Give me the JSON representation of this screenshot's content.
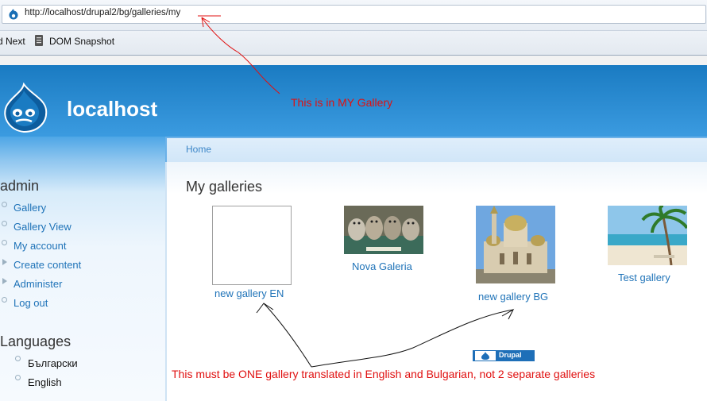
{
  "browser": {
    "url": "http://localhost/drupal2/bg/galleries/my",
    "bookmarks": [
      {
        "label": "d Next"
      },
      {
        "label": "DOM Snapshot"
      }
    ]
  },
  "site": {
    "name": "localhost"
  },
  "breadcrumb": {
    "home": "Home"
  },
  "sidebar": {
    "user_block_title": "admin",
    "nav": [
      {
        "label": "Gallery",
        "marker": "bullet"
      },
      {
        "label": "Gallery View",
        "marker": "bullet"
      },
      {
        "label": "My account",
        "marker": "bullet"
      },
      {
        "label": "Create content",
        "marker": "triangle"
      },
      {
        "label": "Administer",
        "marker": "triangle"
      },
      {
        "label": "Log out",
        "marker": "bullet"
      }
    ],
    "languages_title": "Languages",
    "languages": [
      {
        "label": "Български"
      },
      {
        "label": "English"
      }
    ]
  },
  "main": {
    "page_title": "My galleries",
    "galleries": [
      {
        "label": "new gallery EN",
        "image": "empty-placeholder"
      },
      {
        "label": "Nova Galeria",
        "image": "kittens-photo"
      },
      {
        "label": "new gallery BG",
        "image": "cathedral-photo"
      },
      {
        "label": "Test gallery",
        "image": "beach-palm-photo"
      }
    ]
  },
  "footer": {
    "powered_by": "Drupal"
  },
  "annotations": {
    "note_1": "This is in MY Gallery",
    "note_2": "This must be ONE gallery translated in English and Bulgarian, not 2 separate galleries"
  },
  "colors": {
    "annotation_red": "#e01010",
    "link_blue": "#1f73b8",
    "header_blue": "#1a7bc2"
  }
}
